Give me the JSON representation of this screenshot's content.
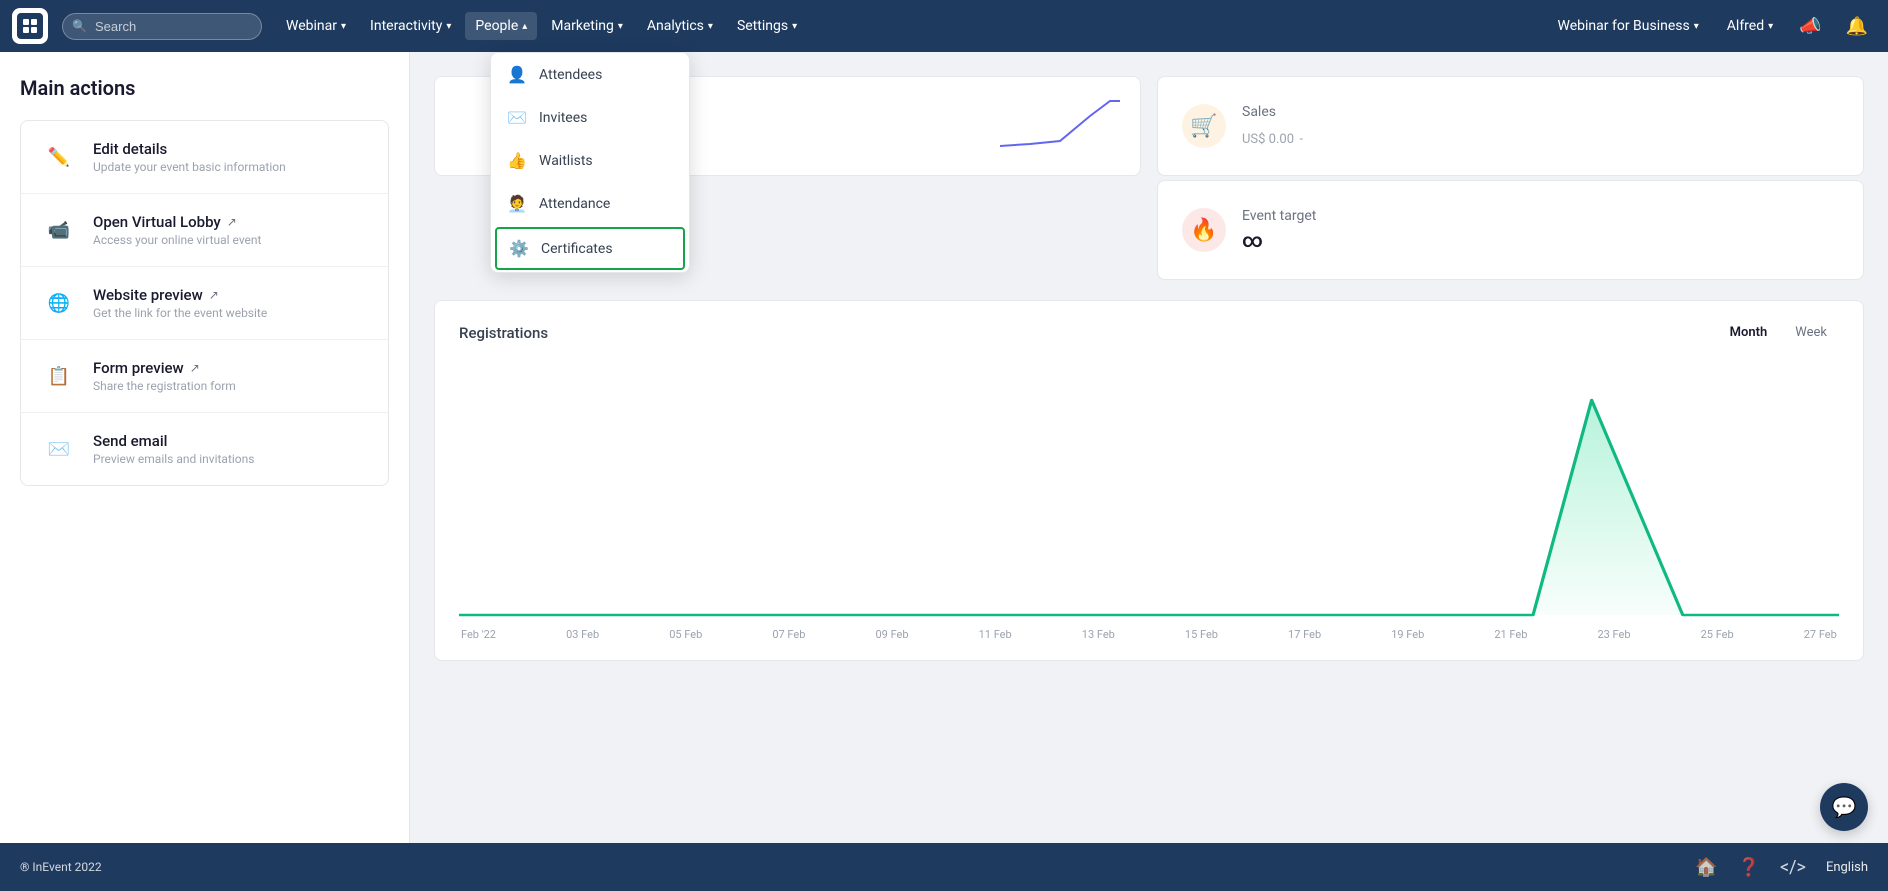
{
  "nav": {
    "search_placeholder": "Search",
    "items": [
      {
        "label": "Webinar",
        "has_dropdown": true
      },
      {
        "label": "Interactivity",
        "has_dropdown": true
      },
      {
        "label": "People",
        "has_dropdown": true,
        "active": true
      },
      {
        "label": "Marketing",
        "has_dropdown": true
      },
      {
        "label": "Analytics",
        "has_dropdown": true
      },
      {
        "label": "Settings",
        "has_dropdown": true
      }
    ],
    "right_items": [
      {
        "label": "Webinar for Business",
        "has_dropdown": true
      },
      {
        "label": "Alfred",
        "has_dropdown": true
      }
    ]
  },
  "sidebar": {
    "title": "Main actions",
    "actions": [
      {
        "icon": "✏️",
        "title": "Edit details",
        "desc": "Update your event basic information",
        "has_ext": false
      },
      {
        "icon": "📹",
        "title": "Open Virtual Lobby",
        "desc": "Access your online virtual event",
        "has_ext": true
      },
      {
        "icon": "🌐",
        "title": "Website preview",
        "desc": "Get the link for the event website",
        "has_ext": true
      },
      {
        "icon": "📋",
        "title": "Form preview",
        "desc": "Share the registration form",
        "has_ext": true
      },
      {
        "icon": "✉️",
        "title": "Send email",
        "desc": "Preview emails and invitations",
        "has_ext": false
      }
    ]
  },
  "people_dropdown": {
    "items": [
      {
        "icon": "👤",
        "label": "Attendees"
      },
      {
        "icon": "✉️",
        "label": "Invitees"
      },
      {
        "icon": "👍",
        "label": "Waitlists"
      },
      {
        "icon": "👤",
        "label": "Attendance"
      },
      {
        "icon": "⚙️",
        "label": "Certificates",
        "highlighted": true
      }
    ]
  },
  "stats": {
    "sales_label": "Sales",
    "sales_value": "US$ 0.00",
    "sales_suffix": "-",
    "event_target_label": "Event target",
    "event_target_value": "∞"
  },
  "chart": {
    "title": "Registrations",
    "tab_month": "Month",
    "tab_week": "Week",
    "x_labels": [
      "Feb '22",
      "03 Feb",
      "05 Feb",
      "07 Feb",
      "09 Feb",
      "11 Feb",
      "13 Feb",
      "15 Feb",
      "17 Feb",
      "19 Feb",
      "21 Feb",
      "23 Feb",
      "25 Feb",
      "27 Feb"
    ]
  },
  "footer": {
    "copyright": "® InEvent 2022",
    "lang": "English"
  }
}
